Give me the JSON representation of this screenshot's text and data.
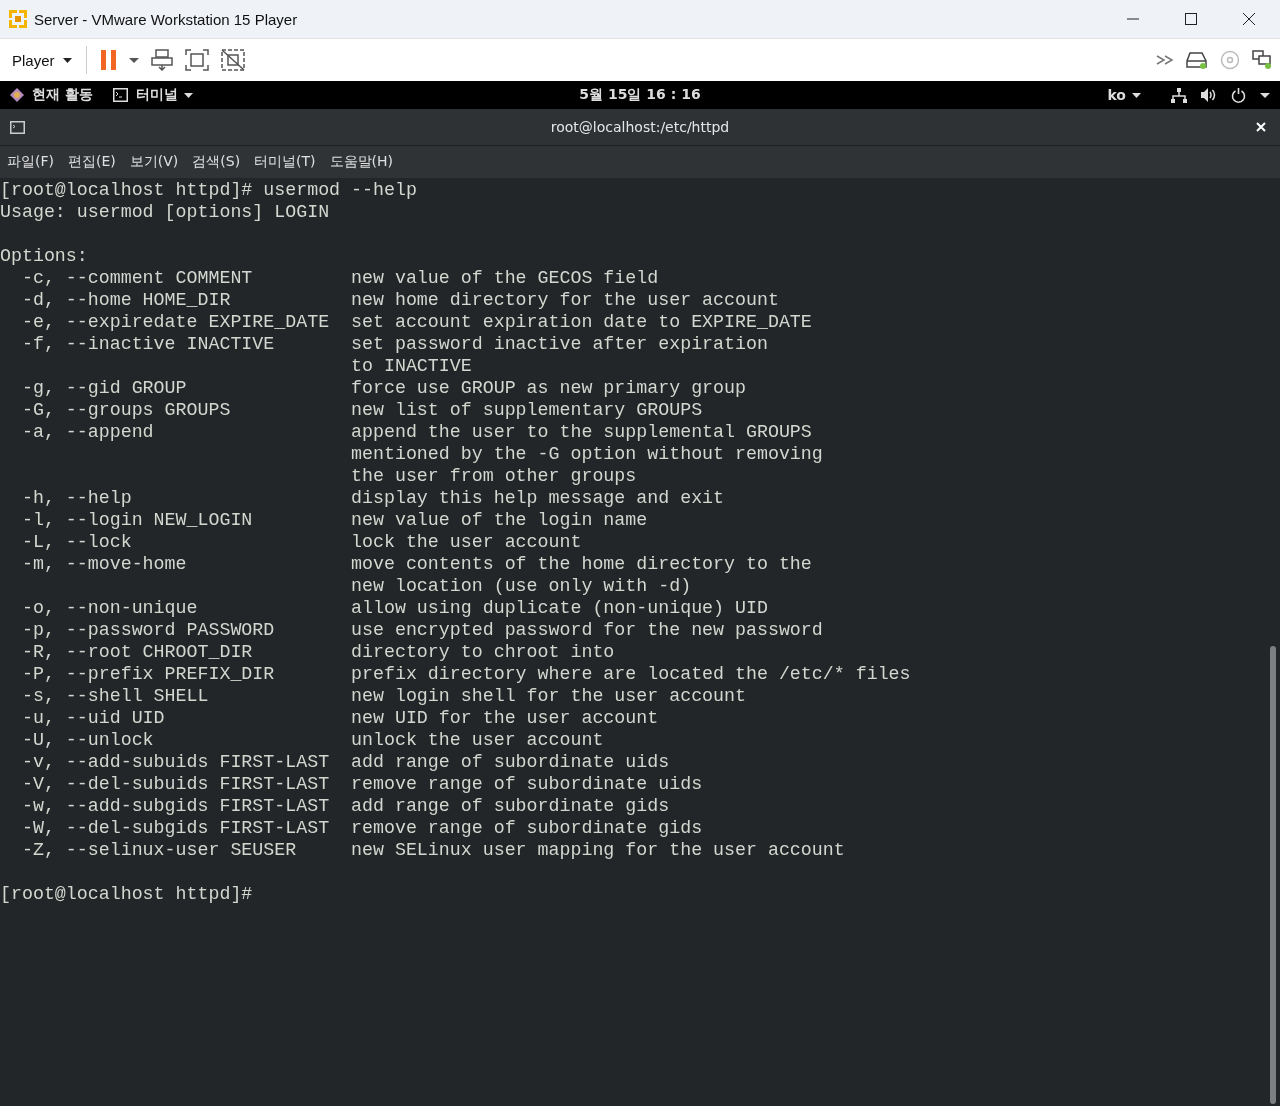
{
  "window": {
    "title": "Server - VMware Workstation 15 Player"
  },
  "toolbar": {
    "player_menu": "Player"
  },
  "top_bar": {
    "activities": "현재 활동",
    "app_menu": "터미널",
    "clock": "5월 15일  16 : 16",
    "input_method": "ko"
  },
  "terminal": {
    "title": "root@localhost:/etc/httpd",
    "menu": [
      "파일(F)",
      "편집(E)",
      "보기(V)",
      "검색(S)",
      "터미널(T)",
      "도움말(H)"
    ],
    "command_line": "[root@localhost httpd]# usermod --help",
    "usage": "Usage: usermod [options] LOGIN",
    "options_heading": "Options:",
    "options": [
      {
        "flag": "-c, --comment COMMENT",
        "description": [
          "new value of the GECOS field"
        ]
      },
      {
        "flag": "-d, --home HOME_DIR",
        "description": [
          "new home directory for the user account"
        ]
      },
      {
        "flag": "-e, --expiredate EXPIRE_DATE",
        "description": [
          "set account expiration date to EXPIRE_DATE"
        ]
      },
      {
        "flag": "-f, --inactive INACTIVE",
        "description": [
          "set password inactive after expiration",
          "to INACTIVE"
        ]
      },
      {
        "flag": "-g, --gid GROUP",
        "description": [
          "force use GROUP as new primary group"
        ]
      },
      {
        "flag": "-G, --groups GROUPS",
        "description": [
          "new list of supplementary GROUPS"
        ]
      },
      {
        "flag": "-a, --append",
        "description": [
          "append the user to the supplemental GROUPS",
          "mentioned by the -G option without removing",
          "the user from other groups"
        ]
      },
      {
        "flag": "-h, --help",
        "description": [
          "display this help message and exit"
        ]
      },
      {
        "flag": "-l, --login NEW_LOGIN",
        "description": [
          "new value of the login name"
        ]
      },
      {
        "flag": "-L, --lock",
        "description": [
          "lock the user account"
        ]
      },
      {
        "flag": "-m, --move-home",
        "description": [
          "move contents of the home directory to the",
          "new location (use only with -d)"
        ]
      },
      {
        "flag": "-o, --non-unique",
        "description": [
          "allow using duplicate (non-unique) UID"
        ]
      },
      {
        "flag": "-p, --password PASSWORD",
        "description": [
          "use encrypted password for the new password"
        ]
      },
      {
        "flag": "-R, --root CHROOT_DIR",
        "description": [
          "directory to chroot into"
        ]
      },
      {
        "flag": "-P, --prefix PREFIX_DIR",
        "description": [
          "prefix directory where are located the /etc/* files"
        ]
      },
      {
        "flag": "-s, --shell SHELL",
        "description": [
          "new login shell for the user account"
        ]
      },
      {
        "flag": "-u, --uid UID",
        "description": [
          "new UID for the user account"
        ]
      },
      {
        "flag": "-U, --unlock",
        "description": [
          "unlock the user account"
        ]
      },
      {
        "flag": "-v, --add-subuids FIRST-LAST",
        "description": [
          "add range of subordinate uids"
        ]
      },
      {
        "flag": "-V, --del-subuids FIRST-LAST",
        "description": [
          "remove range of subordinate uids"
        ]
      },
      {
        "flag": "-w, --add-subgids FIRST-LAST",
        "description": [
          "add range of subordinate gids"
        ]
      },
      {
        "flag": "-W, --del-subgids FIRST-LAST",
        "description": [
          "remove range of subordinate gids"
        ]
      },
      {
        "flag": "-Z, --selinux-user SEUSER",
        "description": [
          "new SELinux user mapping for the user account"
        ]
      }
    ],
    "prompt": "[root@localhost httpd]#"
  }
}
